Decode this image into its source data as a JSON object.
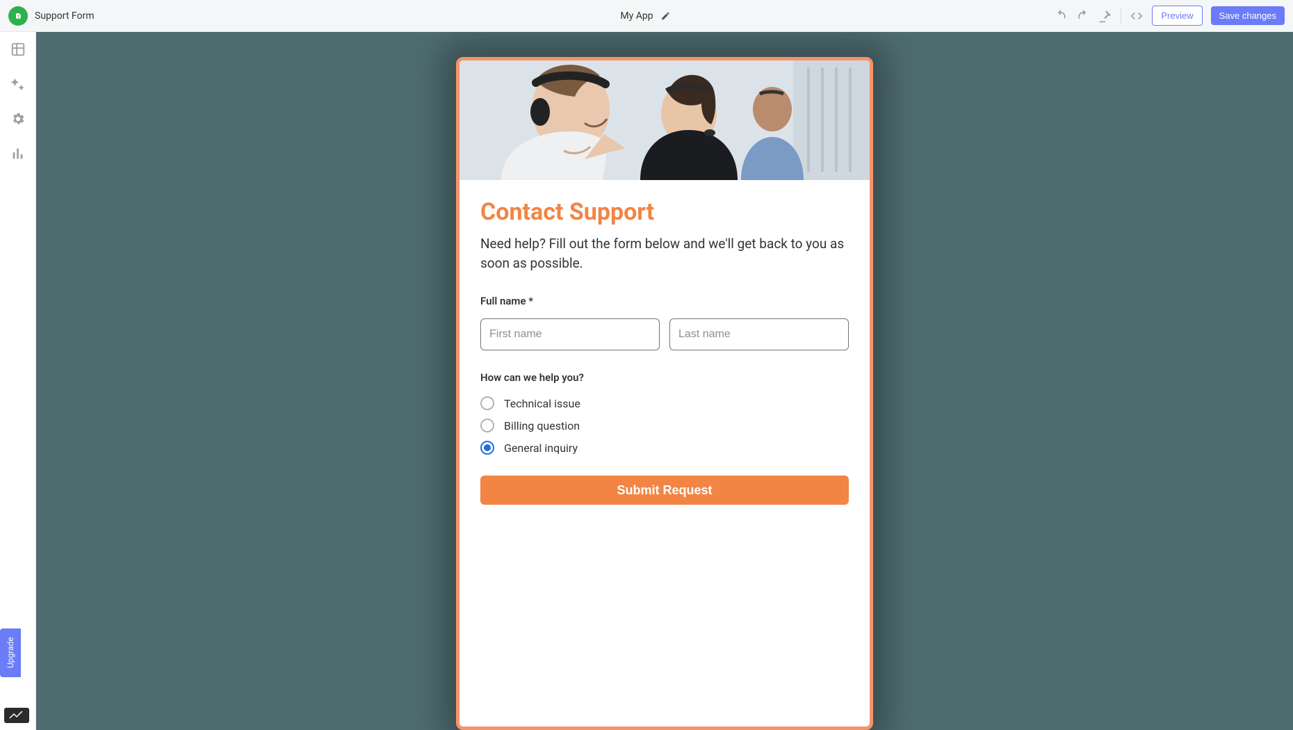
{
  "header": {
    "page_title": "Support Form",
    "app_name": "My App",
    "preview_label": "Preview",
    "save_label": "Save changes"
  },
  "sidebar": {
    "upgrade_label": "Upgrade"
  },
  "form": {
    "title": "Contact Support",
    "description": "Need help? Fill out the form below and we'll get back to you as soon as possible.",
    "fullname_label": "Full name *",
    "first_name_placeholder": "First name",
    "last_name_placeholder": "Last name",
    "help_label": "How can we help you?",
    "options": [
      {
        "label": "Technical issue",
        "selected": false
      },
      {
        "label": "Billing question",
        "selected": false
      },
      {
        "label": "General inquiry",
        "selected": true
      }
    ],
    "submit_label": "Submit Request"
  },
  "colors": {
    "accent_orange": "#f28544",
    "accent_blue": "#6a7cf7",
    "canvas_bg": "#4e6c70"
  }
}
